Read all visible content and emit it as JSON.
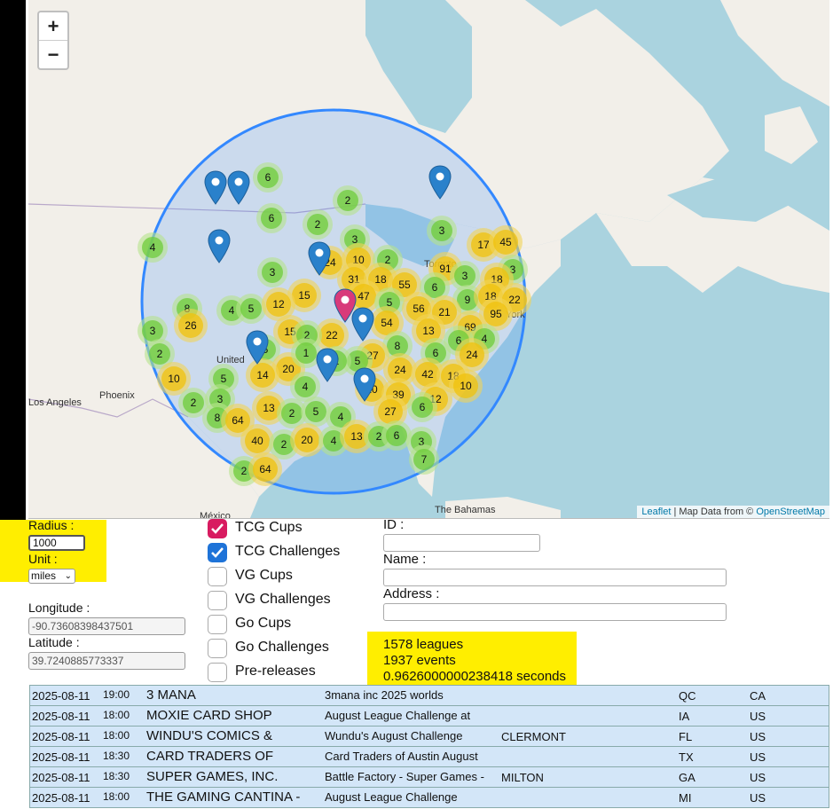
{
  "map": {
    "zoom_in": "+",
    "zoom_out": "−",
    "attribution": {
      "leaflet": "Leaflet",
      "sep": " | Map Data from © ",
      "osm": "OpenStreetMap"
    },
    "place_labels": [
      "Phoenix",
      "Los Angeles",
      "United",
      "The Bahamas",
      "México",
      "Toronto",
      "York"
    ],
    "clusters": [
      {
        "n": "6",
        "c": "green"
      },
      {
        "n": "2",
        "c": "green"
      },
      {
        "n": "6",
        "c": "green"
      },
      {
        "n": "2",
        "c": "green"
      },
      {
        "n": "4",
        "c": "green"
      },
      {
        "n": "3",
        "c": "green"
      },
      {
        "n": "3",
        "c": "green"
      },
      {
        "n": "17",
        "c": "yellow"
      },
      {
        "n": "45",
        "c": "yellow"
      },
      {
        "n": "3",
        "c": "green"
      },
      {
        "n": "24",
        "c": "yellow"
      },
      {
        "n": "10",
        "c": "yellow"
      },
      {
        "n": "2",
        "c": "green"
      },
      {
        "n": "91",
        "c": "yellow"
      },
      {
        "n": "3",
        "c": "green"
      },
      {
        "n": "18",
        "c": "yellow"
      },
      {
        "n": "3",
        "c": "green"
      },
      {
        "n": "31",
        "c": "yellow"
      },
      {
        "n": "18",
        "c": "yellow"
      },
      {
        "n": "55",
        "c": "yellow"
      },
      {
        "n": "6",
        "c": "green"
      },
      {
        "n": "9",
        "c": "green"
      },
      {
        "n": "18",
        "c": "yellow"
      },
      {
        "n": "22",
        "c": "yellow"
      },
      {
        "n": "15",
        "c": "yellow"
      },
      {
        "n": "47",
        "c": "yellow"
      },
      {
        "n": "5",
        "c": "green"
      },
      {
        "n": "56",
        "c": "yellow"
      },
      {
        "n": "21",
        "c": "yellow"
      },
      {
        "n": "95",
        "c": "yellow"
      },
      {
        "n": "8",
        "c": "green"
      },
      {
        "n": "4",
        "c": "green"
      },
      {
        "n": "5",
        "c": "green"
      },
      {
        "n": "12",
        "c": "yellow"
      },
      {
        "n": "26",
        "c": "yellow"
      },
      {
        "n": "22",
        "c": "yellow"
      },
      {
        "n": "54",
        "c": "yellow"
      },
      {
        "n": "13",
        "c": "yellow"
      },
      {
        "n": "69",
        "c": "yellow"
      },
      {
        "n": "3",
        "c": "green"
      },
      {
        "n": "15",
        "c": "yellow"
      },
      {
        "n": "2",
        "c": "green"
      },
      {
        "n": "6",
        "c": "green"
      },
      {
        "n": "4",
        "c": "green"
      },
      {
        "n": "2",
        "c": "green"
      },
      {
        "n": "5",
        "c": "green"
      },
      {
        "n": "8",
        "c": "green"
      },
      {
        "n": "27",
        "c": "yellow"
      },
      {
        "n": "6",
        "c": "green"
      },
      {
        "n": "24",
        "c": "yellow"
      },
      {
        "n": "10",
        "c": "yellow"
      },
      {
        "n": "5",
        "c": "green"
      },
      {
        "n": "20",
        "c": "yellow"
      },
      {
        "n": "1",
        "c": "green"
      },
      {
        "n": "2",
        "c": "green"
      },
      {
        "n": "5",
        "c": "green"
      },
      {
        "n": "24",
        "c": "yellow"
      },
      {
        "n": "42",
        "c": "yellow"
      },
      {
        "n": "18",
        "c": "yellow"
      },
      {
        "n": "10",
        "c": "yellow"
      },
      {
        "n": "14",
        "c": "yellow"
      },
      {
        "n": "4",
        "c": "green"
      },
      {
        "n": "20",
        "c": "yellow"
      },
      {
        "n": "39",
        "c": "yellow"
      },
      {
        "n": "12",
        "c": "yellow"
      },
      {
        "n": "6",
        "c": "green"
      },
      {
        "n": "3",
        "c": "green"
      },
      {
        "n": "2",
        "c": "green"
      },
      {
        "n": "8",
        "c": "green"
      },
      {
        "n": "64",
        "c": "yellow"
      },
      {
        "n": "13",
        "c": "yellow"
      },
      {
        "n": "2",
        "c": "green"
      },
      {
        "n": "5",
        "c": "green"
      },
      {
        "n": "4",
        "c": "green"
      },
      {
        "n": "27",
        "c": "yellow"
      },
      {
        "n": "40",
        "c": "yellow"
      },
      {
        "n": "2",
        "c": "green"
      },
      {
        "n": "20",
        "c": "yellow"
      },
      {
        "n": "4",
        "c": "green"
      },
      {
        "n": "13",
        "c": "yellow"
      },
      {
        "n": "2",
        "c": "green"
      },
      {
        "n": "6",
        "c": "green"
      },
      {
        "n": "3",
        "c": "green"
      },
      {
        "n": "2",
        "c": "green"
      },
      {
        "n": "64",
        "c": "yellow"
      },
      {
        "n": "7",
        "c": "green"
      }
    ]
  },
  "form": {
    "radius_label": "Radius :",
    "radius_value": "1000",
    "unit_label": "Unit :",
    "unit_value": "miles",
    "longitude_label": "Longitude :",
    "longitude_value": "-90.73608398437501",
    "latitude_label": "Latitude :",
    "latitude_value": "39.7240885773337",
    "id_label": "ID :",
    "name_label": "Name :",
    "address_label": "Address :"
  },
  "filters": [
    {
      "label": "TCG Cups",
      "checked": true,
      "color": "#d81b60"
    },
    {
      "label": "TCG Challenges",
      "checked": true,
      "color": "#1e73d8"
    },
    {
      "label": "VG Cups",
      "checked": false
    },
    {
      "label": "VG Challenges",
      "checked": false
    },
    {
      "label": "Go Cups",
      "checked": false
    },
    {
      "label": "Go Challenges",
      "checked": false
    },
    {
      "label": "Pre-releases",
      "checked": false
    }
  ],
  "stats": {
    "leagues": "1578 leagues",
    "events": "1937 events",
    "time": "0.9626000000238418 seconds"
  },
  "highlight_color": "#ffee00",
  "events": [
    {
      "date": "2025-08-11",
      "time": "19:00",
      "store": "3 MANA",
      "event": "3mana inc 2025 worlds",
      "city": "",
      "state": "QC",
      "country": "CA"
    },
    {
      "date": "2025-08-11",
      "time": "18:00",
      "store": "MOXIE CARD SHOP",
      "event": "August League Challenge at",
      "city": "",
      "state": "IA",
      "country": "US"
    },
    {
      "date": "2025-08-11",
      "time": "18:00",
      "store": "WINDU'S COMICS &",
      "event": "Wundu's August Challenge",
      "city": "CLERMONT",
      "state": "FL",
      "country": "US"
    },
    {
      "date": "2025-08-11",
      "time": "18:30",
      "store": "CARD TRADERS OF",
      "event": "Card Traders of Austin August",
      "city": "",
      "state": "TX",
      "country": "US"
    },
    {
      "date": "2025-08-11",
      "time": "18:30",
      "store": "SUPER GAMES, INC.",
      "event": "Battle Factory - Super Games -",
      "city": "MILTON",
      "state": "GA",
      "country": "US"
    },
    {
      "date": "2025-08-11",
      "time": "18:00",
      "store": "THE GAMING CANTINA -",
      "event": "August League Challenge",
      "city": "",
      "state": "MI",
      "country": "US"
    }
  ]
}
